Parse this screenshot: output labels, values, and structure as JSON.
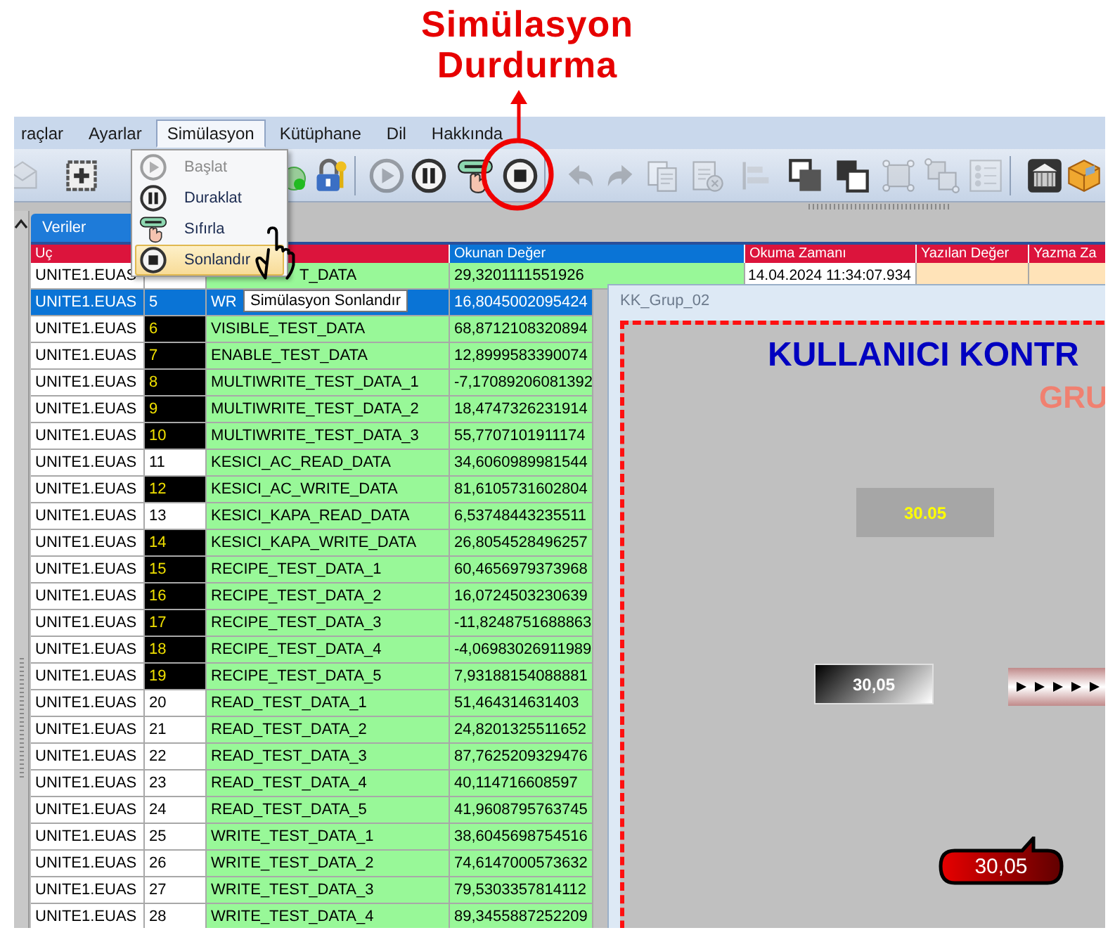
{
  "annotation": {
    "title_lines": [
      "Simülasyon",
      "Durdurma"
    ]
  },
  "menu_bar": [
    {
      "label": "raçlar",
      "selected": false
    },
    {
      "label": "Ayarlar",
      "selected": false
    },
    {
      "label": "Simülasyon",
      "selected": true
    },
    {
      "label": "Kütüphane",
      "selected": false
    },
    {
      "label": "Dil",
      "selected": false
    },
    {
      "label": "Hakkında",
      "selected": false
    }
  ],
  "simulation_menu": {
    "items": [
      {
        "label": "Başlat",
        "disabled": true,
        "selected": false
      },
      {
        "label": "Duraklat",
        "disabled": false,
        "selected": false
      },
      {
        "label": "Sıfırla",
        "disabled": false,
        "selected": false
      },
      {
        "label": "Sonlandır",
        "disabled": false,
        "selected": true
      }
    ]
  },
  "toolbar": [
    {
      "disabled": true
    },
    {
      "disabled": false
    },
    {
      "disabled": false
    },
    {
      "disabled": false
    },
    {
      "disabled": true
    },
    {
      "disabled": false
    },
    {
      "disabled": false
    },
    {
      "disabled": false
    },
    {
      "disabled": true
    },
    {
      "disabled": true
    },
    {
      "disabled": true
    },
    {
      "disabled": true
    },
    {
      "disabled": true
    },
    {
      "disabled": false
    },
    {
      "disabled": false
    },
    {
      "disabled": true
    },
    {
      "disabled": true
    },
    {
      "disabled": true
    },
    {
      "disabled": false
    },
    {
      "disabled": false
    }
  ],
  "tabs": [
    {
      "label": "Veriler",
      "selected": true
    }
  ],
  "table": {
    "columns": [
      {
        "label": "Uç",
        "selected": false
      },
      {
        "label": "Okunan Değer",
        "selected": true
      },
      {
        "label": "Okuma Zamanı",
        "selected": false
      },
      {
        "label": "Yazılan Değer",
        "selected": false
      },
      {
        "label": "Yazma Za",
        "selected": false
      }
    ],
    "rows": [
      {
        "source": "UNITE1.EUAS",
        "name": "T_DATA",
        "value": "29,3201111551926",
        "read_time": "14.04.2024 11:34:07.934",
        "selected": false,
        "flagged": false
      },
      {
        "source": "UNITE1.EUAS",
        "index": "5",
        "name": "WR",
        "value": "16,8045002095424",
        "selected": true,
        "flagged": false
      },
      {
        "source": "UNITE1.EUAS",
        "index": "6",
        "name": "VISIBLE_TEST_DATA",
        "value": "68,8712108320894",
        "selected": false,
        "flagged": true
      },
      {
        "source": "UNITE1.EUAS",
        "index": "7",
        "name": "ENABLE_TEST_DATA",
        "value": "12,8999583390074",
        "selected": false,
        "flagged": true
      },
      {
        "source": "UNITE1.EUAS",
        "index": "8",
        "name": "MULTIWRITE_TEST_DATA_1",
        "value": "-7,17089206081392",
        "selected": false,
        "flagged": true
      },
      {
        "source": "UNITE1.EUAS",
        "index": "9",
        "name": "MULTIWRITE_TEST_DATA_2",
        "value": "18,4747326231914",
        "selected": false,
        "flagged": true
      },
      {
        "source": "UNITE1.EUAS",
        "index": "10",
        "name": "MULTIWRITE_TEST_DATA_3",
        "value": "55,7707101911174",
        "selected": false,
        "flagged": true
      },
      {
        "source": "UNITE1.EUAS",
        "index": "11",
        "name": "KESICI_AC_READ_DATA",
        "value": "34,6060989981544",
        "selected": false,
        "flagged": false
      },
      {
        "source": "UNITE1.EUAS",
        "index": "12",
        "name": "KESICI_AC_WRITE_DATA",
        "value": "81,6105731602804",
        "selected": false,
        "flagged": true
      },
      {
        "source": "UNITE1.EUAS",
        "index": "13",
        "name": "KESICI_KAPA_READ_DATA",
        "value": "6,53748443235511",
        "selected": false,
        "flagged": false
      },
      {
        "source": "UNITE1.EUAS",
        "index": "14",
        "name": "KESICI_KAPA_WRITE_DATA",
        "value": "26,8054528496257",
        "selected": false,
        "flagged": true
      },
      {
        "source": "UNITE1.EUAS",
        "index": "15",
        "name": "RECIPE_TEST_DATA_1",
        "value": "60,4656979373968",
        "selected": false,
        "flagged": true
      },
      {
        "source": "UNITE1.EUAS",
        "index": "16",
        "name": "RECIPE_TEST_DATA_2",
        "value": "16,0724503230639",
        "selected": false,
        "flagged": true
      },
      {
        "source": "UNITE1.EUAS",
        "index": "17",
        "name": "RECIPE_TEST_DATA_3",
        "value": "-11,8248751688863",
        "selected": false,
        "flagged": true
      },
      {
        "source": "UNITE1.EUAS",
        "index": "18",
        "name": "RECIPE_TEST_DATA_4",
        "value": "-4,06983026911989",
        "selected": false,
        "flagged": true
      },
      {
        "source": "UNITE1.EUAS",
        "index": "19",
        "name": "RECIPE_TEST_DATA_5",
        "value": "7,93188154088881",
        "selected": false,
        "flagged": true
      },
      {
        "source": "UNITE1.EUAS",
        "index": "20",
        "name": "READ_TEST_DATA_1",
        "value": "51,464314631403",
        "selected": false,
        "flagged": false
      },
      {
        "source": "UNITE1.EUAS",
        "index": "21",
        "name": "READ_TEST_DATA_2",
        "value": "24,8201325511652",
        "selected": false,
        "flagged": false
      },
      {
        "source": "UNITE1.EUAS",
        "index": "22",
        "name": "READ_TEST_DATA_3",
        "value": "87,7625209329476",
        "selected": false,
        "flagged": false
      },
      {
        "source": "UNITE1.EUAS",
        "index": "23",
        "name": "READ_TEST_DATA_4",
        "value": "40,114716608597",
        "selected": false,
        "flagged": false
      },
      {
        "source": "UNITE1.EUAS",
        "index": "24",
        "name": "READ_TEST_DATA_5",
        "value": "41,9608795763745",
        "selected": false,
        "flagged": false
      },
      {
        "source": "UNITE1.EUAS",
        "index": "25",
        "name": "WRITE_TEST_DATA_1",
        "value": "38,6045698754516",
        "selected": false,
        "flagged": false
      },
      {
        "source": "UNITE1.EUAS",
        "index": "26",
        "name": "WRITE_TEST_DATA_2",
        "value": "74,6147000573632",
        "selected": false,
        "flagged": false
      },
      {
        "source": "UNITE1.EUAS",
        "index": "27",
        "name": "WRITE_TEST_DATA_3",
        "value": "79,5303357814112",
        "selected": false,
        "flagged": false
      },
      {
        "source": "UNITE1.EUAS",
        "index": "28",
        "name": "WRITE_TEST_DATA_4",
        "value": "89,3455887252209",
        "selected": false,
        "flagged": false
      }
    ]
  },
  "tooltip": "Simülasyon Sonlandır",
  "window": {
    "title": "KK_Grup_02",
    "heading": "KULLANICI KONTR",
    "subheading": "GRU",
    "display_value": "30.05",
    "gradient_value": "30,05",
    "callout_value": "30,05"
  }
}
